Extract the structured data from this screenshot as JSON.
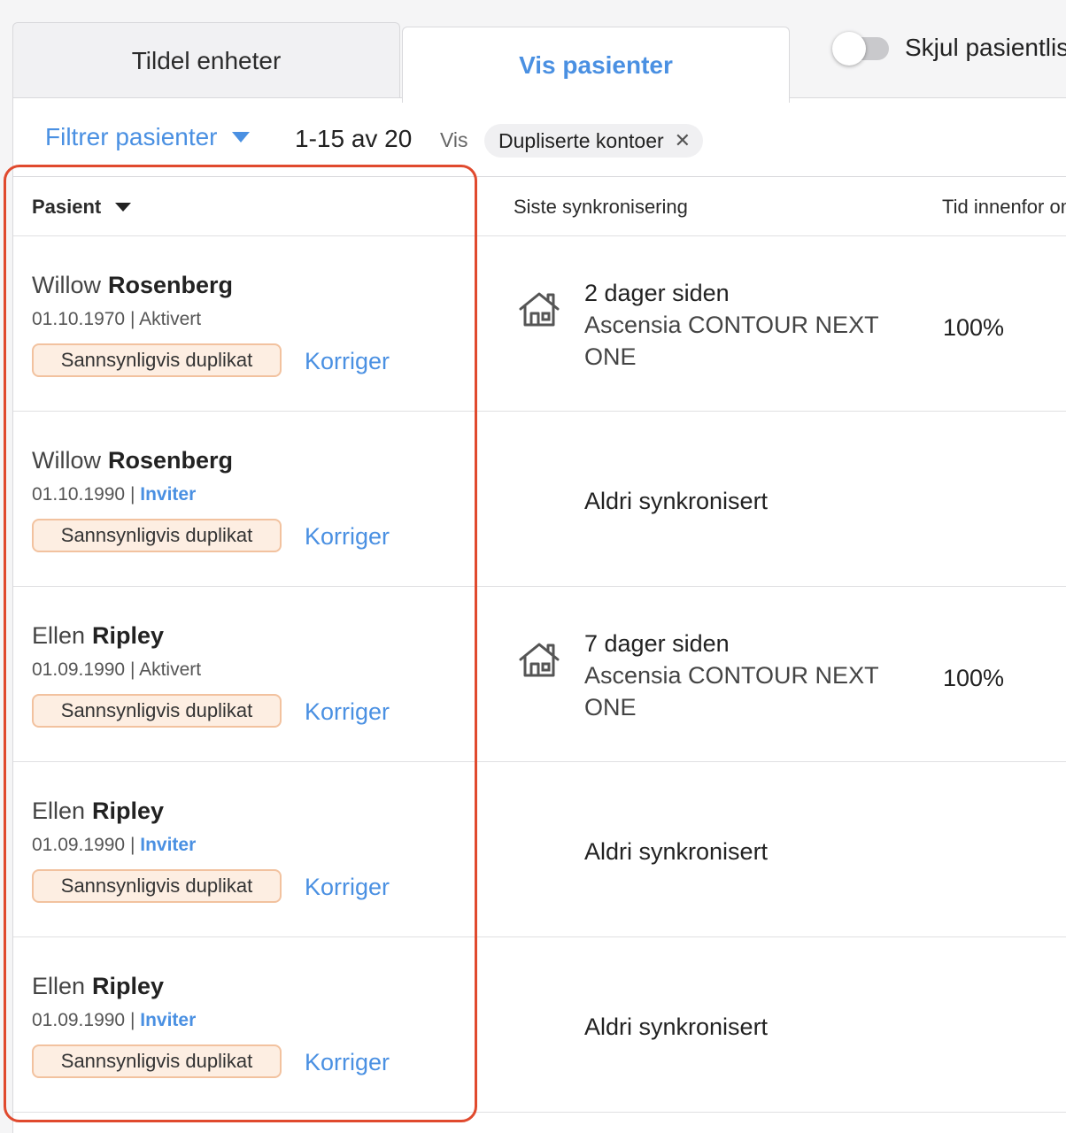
{
  "tabs": {
    "assign_label": "Tildel enheter",
    "patients_label": "Vis pasienter"
  },
  "toggle": {
    "label": "Skjul pasientliste",
    "checked": false
  },
  "toolbar": {
    "filter_label": "Filtrer pasienter",
    "range": "1-15 av 20",
    "show_label": "Vis",
    "chip_label": "Dupliserte kontoer",
    "chip_close": "✕"
  },
  "columns": {
    "patient": "Pasient",
    "last_sync": "Siste synkronisering",
    "time_in_range": "Tid innenfor område"
  },
  "rows": [
    {
      "first": "Willow",
      "last": "Rosenberg",
      "dob": "01.10.1970",
      "status": "Aktivert",
      "status_type": "activated",
      "badge": "Sannsynligvis duplikat",
      "action": "Korriger",
      "sync_when": "2 dager siden",
      "sync_device": "Ascensia CONTOUR NEXT ONE",
      "tir": "100%",
      "never": ""
    },
    {
      "first": "Willow",
      "last": "Rosenberg",
      "dob": "01.10.1990",
      "status": "Inviter",
      "status_type": "invite",
      "badge": "Sannsynligvis duplikat",
      "action": "Korriger",
      "sync_when": "",
      "sync_device": "",
      "tir": "",
      "never": "Aldri synkronisert"
    },
    {
      "first": "Ellen",
      "last": "Ripley",
      "dob": "01.09.1990",
      "status": "Aktivert",
      "status_type": "activated",
      "badge": "Sannsynligvis duplikat",
      "action": "Korriger",
      "sync_when": "7 dager siden",
      "sync_device": "Ascensia CONTOUR NEXT ONE",
      "tir": "100%",
      "never": ""
    },
    {
      "first": "Ellen",
      "last": "Ripley",
      "dob": "01.09.1990",
      "status": "Inviter",
      "status_type": "invite",
      "badge": "Sannsynligvis duplikat",
      "action": "Korriger",
      "sync_when": "",
      "sync_device": "",
      "tir": "",
      "never": "Aldri synkronisert"
    },
    {
      "first": "Ellen",
      "last": "Ripley",
      "dob": "01.09.1990",
      "status": "Inviter",
      "status_type": "invite",
      "badge": "Sannsynligvis duplikat",
      "action": "Korriger",
      "sync_when": "",
      "sync_device": "",
      "tir": "",
      "never": "Aldri synkronisert"
    }
  ],
  "icons": {
    "home": "home-icon",
    "filter_caret": "caret-down-icon",
    "sort_caret": "caret-down-icon"
  },
  "colors": {
    "accent": "#4a90e2",
    "badge_bg": "#fdeee2",
    "badge_border": "#f2c29f",
    "highlight": "#e04a2e"
  }
}
